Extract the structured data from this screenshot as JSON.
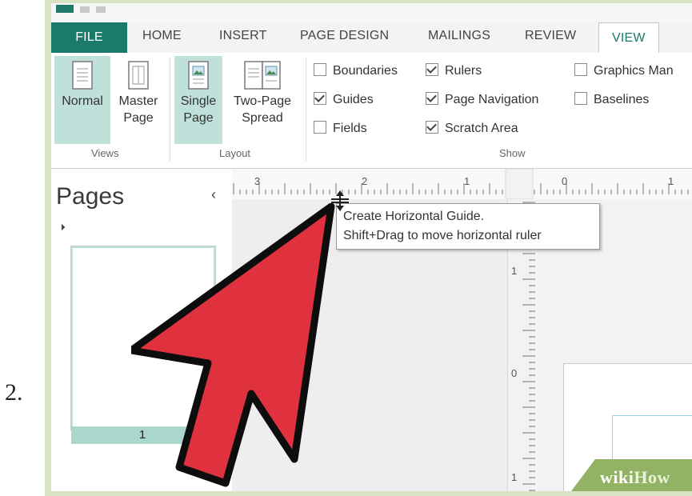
{
  "step": "2.",
  "tabs": [
    "FILE",
    "HOME",
    "INSERT",
    "PAGE DESIGN",
    "MAILINGS",
    "REVIEW",
    "VIEW"
  ],
  "active_tab": "VIEW",
  "ribbon": {
    "views": {
      "normal": "Normal",
      "master_line1": "Master",
      "master_line2": "Page",
      "group": "Views"
    },
    "layout": {
      "single_line1": "Single",
      "single_line2": "Page",
      "two_line1": "Two-Page",
      "two_line2": "Spread",
      "group": "Layout"
    },
    "show": {
      "boundaries": "Boundaries",
      "guides": "Guides",
      "fields": "Fields",
      "rulers": "Rulers",
      "page_navigation": "Page Navigation",
      "scratch_area": "Scratch Area",
      "graphics_manager": "Graphics Man",
      "baselines": "Baselines",
      "group": "Show",
      "checked": {
        "boundaries": false,
        "guides": true,
        "fields": false,
        "rulers": true,
        "page_navigation": true,
        "scratch_area": true,
        "graphics_manager": false,
        "baselines": false
      }
    }
  },
  "pages_panel": {
    "title": "Pages",
    "collapse": "‹",
    "page_number": "1"
  },
  "ruler_h_labels": [
    "3",
    "2",
    "1",
    "0",
    "1"
  ],
  "ruler_v_labels": [
    "1",
    "0",
    "1"
  ],
  "tooltip": {
    "line1": "Create Horizontal Guide.",
    "line2": "Shift+Drag to move horizontal ruler"
  },
  "watermark": {
    "wiki": "wiki",
    "how": "How"
  },
  "colors": {
    "accent": "#1b7a69",
    "selected": "#bfe1da",
    "arrow_fill": "#e0313f",
    "frame": "#d7e3c2"
  }
}
